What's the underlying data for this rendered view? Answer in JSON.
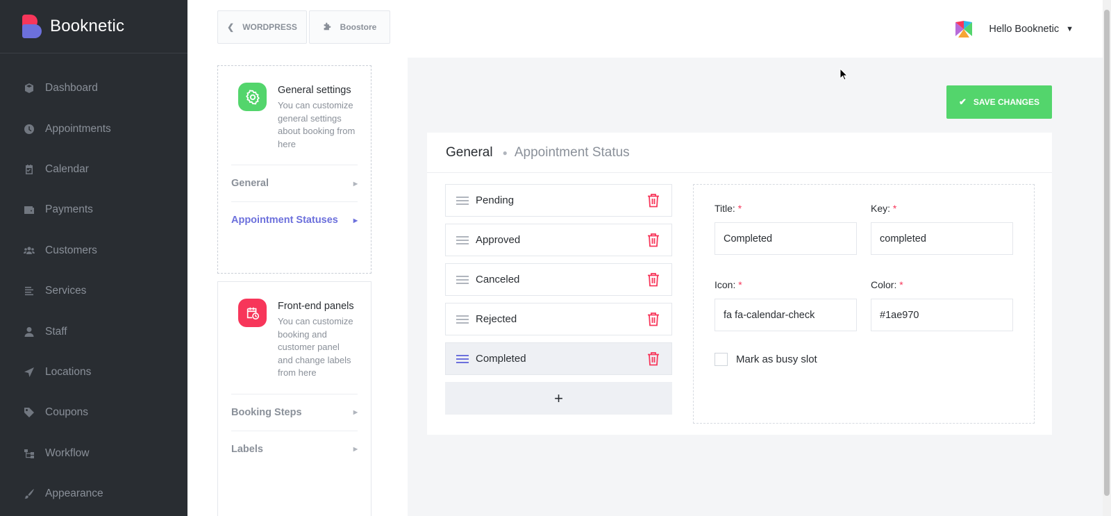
{
  "brand": {
    "name": "Booknetic",
    "colors": {
      "top": "#f7365a",
      "bottom": "#6c70dc"
    }
  },
  "sidebar": {
    "items": [
      {
        "label": "Dashboard",
        "icon": "cube-icon"
      },
      {
        "label": "Appointments",
        "icon": "clock-icon"
      },
      {
        "label": "Calendar",
        "icon": "calendar-icon"
      },
      {
        "label": "Payments",
        "icon": "wallet-icon"
      },
      {
        "label": "Customers",
        "icon": "users-icon"
      },
      {
        "label": "Services",
        "icon": "list-icon"
      },
      {
        "label": "Staff",
        "icon": "user-icon"
      },
      {
        "label": "Locations",
        "icon": "location-arrow-icon"
      },
      {
        "label": "Coupons",
        "icon": "tag-icon"
      },
      {
        "label": "Workflow",
        "icon": "sitemap-icon"
      },
      {
        "label": "Appearance",
        "icon": "brush-icon"
      }
    ]
  },
  "topbar": {
    "wordpress_label": "WORDPRESS",
    "boostore_label": "Boostore",
    "user_greeting": "Hello Booknetic"
  },
  "settings_cards": [
    {
      "title": "General settings",
      "description": "You can customize general settings about booking from here",
      "icon": "gear-icon",
      "icon_color": "#53d56c",
      "links": [
        {
          "label": "General",
          "active": false
        },
        {
          "label": "Appointment Statuses",
          "active": true
        }
      ]
    },
    {
      "title": "Front-end panels",
      "description": "You can customize booking and customer panel and change labels from here",
      "icon": "calendar-clock-icon",
      "icon_color": "#f7365a",
      "links": [
        {
          "label": "Booking Steps",
          "active": false
        },
        {
          "label": "Labels",
          "active": false
        }
      ]
    }
  ],
  "save_button": {
    "label": "SAVE CHANGES",
    "color": "#53d56c"
  },
  "panel": {
    "title": "General",
    "subtitle": "Appointment Status",
    "statuses": [
      {
        "label": "Pending",
        "active": false
      },
      {
        "label": "Approved",
        "active": false
      },
      {
        "label": "Canceled",
        "active": false
      },
      {
        "label": "Rejected",
        "active": false
      },
      {
        "label": "Completed",
        "active": true
      }
    ],
    "add_label": "+",
    "form": {
      "title_label": "Title:",
      "title_value": "Completed",
      "key_label": "Key:",
      "key_value": "completed",
      "icon_label": "Icon:",
      "icon_value": "fa fa-calendar-check",
      "color_label": "Color:",
      "color_value": "#1ae970",
      "required_mark": "*",
      "busy_slot_label": "Mark as busy slot",
      "busy_slot_checked": false
    }
  },
  "accent_color": "#6c70dc",
  "danger_color": "#f7365a"
}
